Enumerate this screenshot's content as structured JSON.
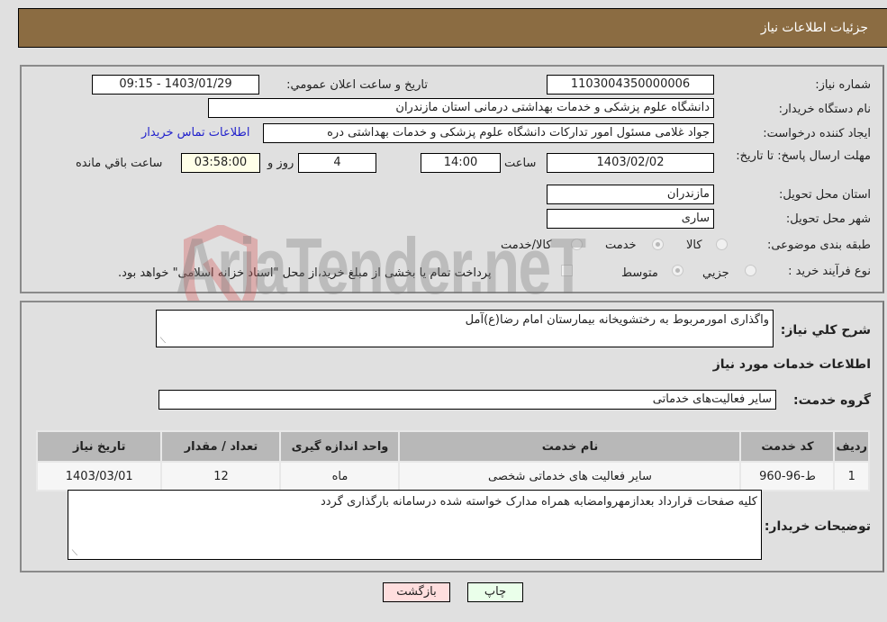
{
  "header": {
    "title": "جزئیات اطلاعات نیاز"
  },
  "form": {
    "need_number": {
      "label": "شماره نیاز:",
      "value": "1103004350000006"
    },
    "announce_datetime": {
      "label": "تاریخ و ساعت اعلان عمومي:",
      "value": "1403/01/29 - 09:15"
    },
    "buyer_org": {
      "label": "نام دستگاه خریدار:",
      "value": "دانشگاه علوم پزشکی و خدمات بهداشتی  درمانی استان مازندران"
    },
    "requester": {
      "label": "ایجاد کننده درخواست:",
      "value": "جواد غلامی مسئول امور تدارکات دانشگاه علوم پزشکی و خدمات بهداشتی  دره",
      "contact_link": "اطلاعات تماس خریدار"
    },
    "deadline": {
      "label": "مهلت ارسال پاسخ: تا تاریخ:",
      "date": "1403/02/02",
      "time_label": "ساعت",
      "time": "14:00",
      "days": "4",
      "days_label": "روز و",
      "remaining": "03:58:00",
      "remaining_label": "ساعت باقي مانده"
    },
    "province": {
      "label": "استان محل تحویل:",
      "value": "مازندران"
    },
    "city": {
      "label": "شهر محل تحویل:",
      "value": "ساری"
    },
    "category": {
      "label": "طبقه بندی موضوعی:",
      "options": [
        "کالا",
        "خدمت",
        "کالا/خدمت"
      ],
      "selected": "خدمت"
    },
    "purchase_type": {
      "label": "نوع فرآیند خرید :",
      "options": [
        "جزیي",
        "متوسط"
      ],
      "selected": "متوسط",
      "treasury_note": "پرداخت تمام یا بخشی از مبلغ خرید،از محل \"اسناد خزانه اسلامی\" خواهد بود."
    }
  },
  "details": {
    "description_label": "شرح کلي نیاز:",
    "description": "واگذاری امورمربوط به رختشویخانه بیمارستان امام رضا(ع)آمل",
    "services_heading": "اطلاعات خدمات مورد نیاز",
    "service_group_label": "گروه خدمت:",
    "service_group": "سایر فعالیت‌های خدماتی",
    "table": {
      "headers": [
        "ردیف",
        "کد خدمت",
        "نام خدمت",
        "واحد اندازه گیری",
        "تعداد / مقدار",
        "تاریخ نیاز"
      ],
      "rows": [
        [
          "1",
          "ط-96-960",
          "سایر فعالیت های خدماتی شخصی",
          "ماه",
          "12",
          "1403/03/01"
        ]
      ]
    },
    "buyer_notes_label": "توضیحات خریدار:",
    "buyer_notes": "کلیه صفحات قرارداد بعدازمهروامضابه همراه مدارک خواسته شده درسامانه بارگذاری گردد"
  },
  "buttons": {
    "print": "چاپ",
    "back": "بازگشت"
  },
  "watermark": "AriaTender.neT",
  "colors": {
    "header_bg": "#8b6c42",
    "print_bg": "#eaffea",
    "back_bg": "#ffdede",
    "remaining_bg": "#ffffe8",
    "link": "#2222cc"
  }
}
